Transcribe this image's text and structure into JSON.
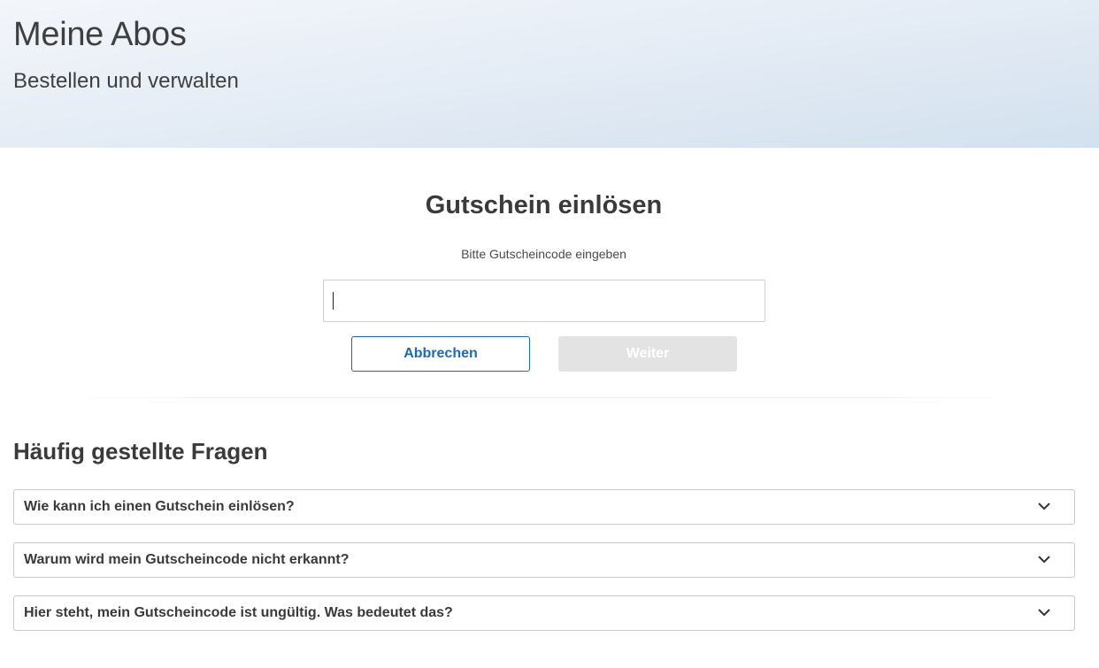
{
  "hero": {
    "title": "Meine Abos",
    "subtitle": "Bestellen und verwalten"
  },
  "voucher": {
    "title": "Gutschein einlösen",
    "prompt": "Bitte Gutscheincode eingeben",
    "input_value": "",
    "input_placeholder": "",
    "cancel_label": "Abbrechen",
    "next_label": "Weiter",
    "next_enabled": false
  },
  "faq": {
    "title": "Häufig gestellte Fragen",
    "items": [
      {
        "question": "Wie kann ich einen Gutschein einlösen?",
        "icon": "chevron-down-icon"
      },
      {
        "question": "Warum wird mein Gutscheincode nicht erkannt?",
        "icon": "chevron-down-icon"
      },
      {
        "question": "Hier steht, mein Gutscheincode ist ungültig. Was bedeutet das?",
        "icon": "chevron-down-icon"
      }
    ]
  },
  "colors": {
    "accent": "#1d6ab3",
    "disabled_button": "#e3e3e3",
    "text": "#3a3a3a"
  }
}
